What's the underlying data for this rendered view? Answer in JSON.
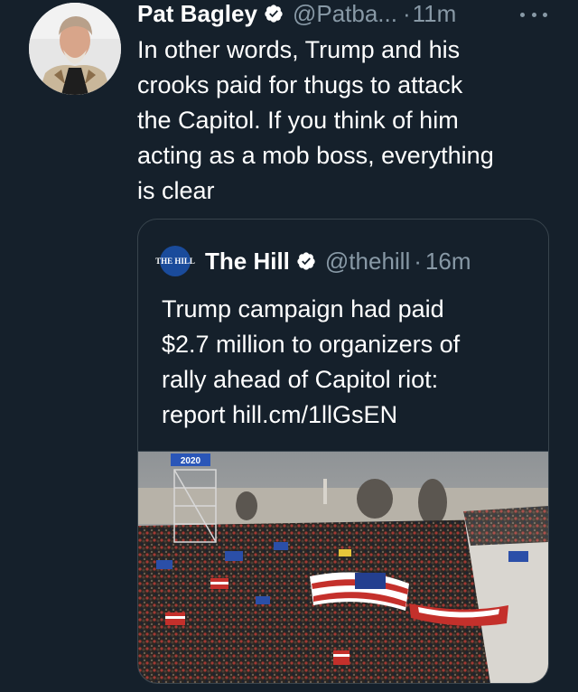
{
  "tweet": {
    "author_name": "Pat Bagley",
    "author_handle": "@Patba...",
    "dot": "·",
    "time": "11m",
    "text": "In other words, Trump and his\ncrooks paid for thugs to attack\nthe Capitol. If you think of him\nacting as a mob boss, everything\nis clear",
    "avatar_icon": "profile-photo"
  },
  "quote": {
    "logo_text": "THE HILL",
    "author_name": "The Hill",
    "author_handle": "@thehill",
    "dot": "·",
    "time": "16m",
    "text": "Trump campaign had paid\n$2.7 million to organizers of\nrally ahead of Capitol riot:\nreport hill.cm/1llGsEN",
    "photo_sign_text": "2020"
  },
  "icons": {
    "verified": "verified-badge-icon",
    "more": "more-options-icon"
  },
  "colors": {
    "background": "#15202b",
    "secondary_text": "#8899a6",
    "border": "#38444d",
    "text": "#ffffff"
  }
}
